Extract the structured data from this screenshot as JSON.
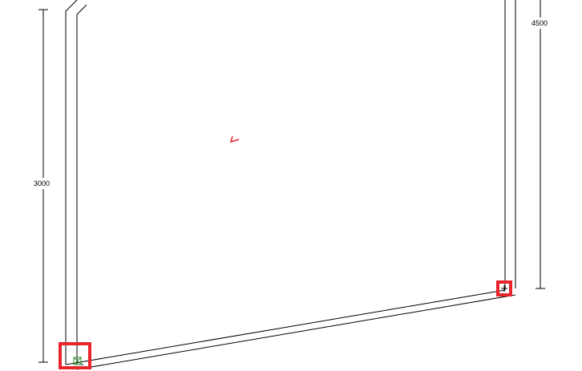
{
  "viewport": {
    "dimensions": {
      "left_height": "3000",
      "right_height": "4500"
    },
    "colors": {
      "lines": "#000000",
      "highlight": "#e8242c",
      "marker": "#2f8f2f",
      "axis_marker": "#e8242c"
    },
    "icons": {
      "axis": "axis-indicator-icon",
      "snap_left": "snap-point-icon",
      "snap_right": "snap-point-icon"
    }
  }
}
